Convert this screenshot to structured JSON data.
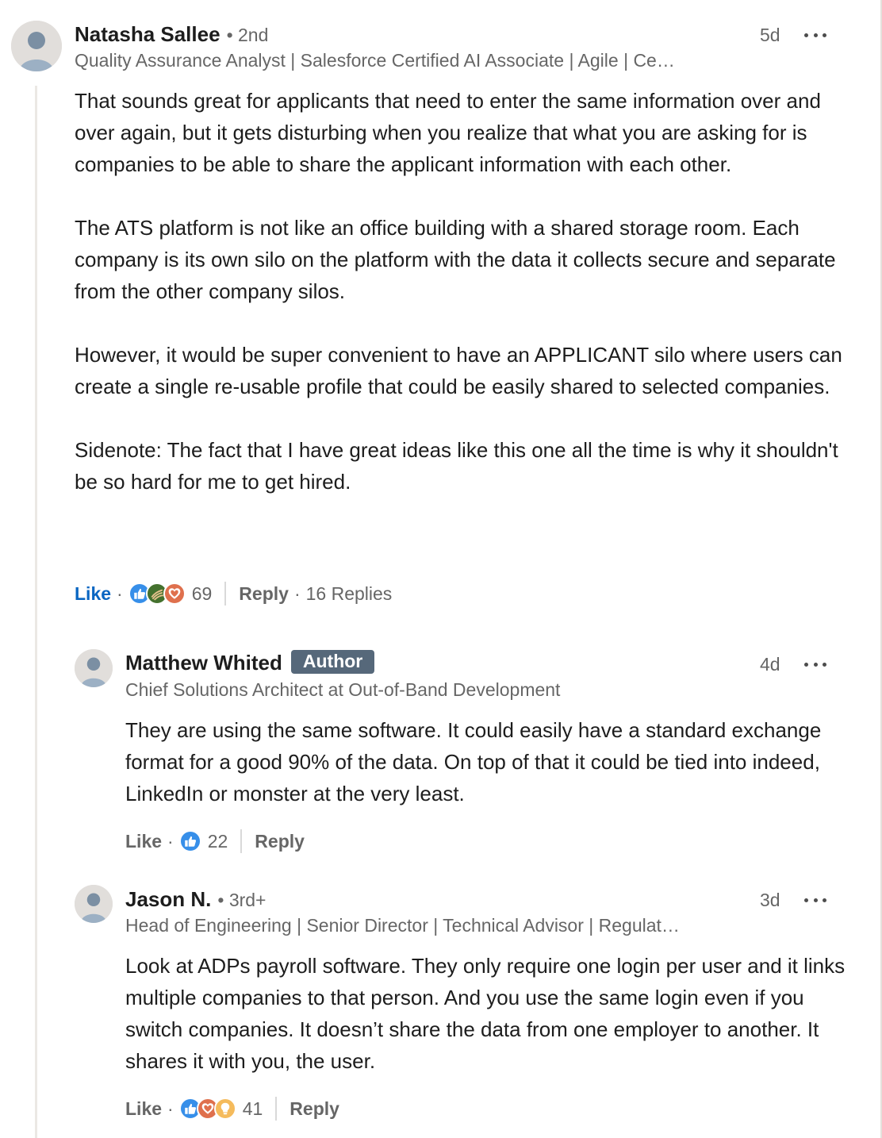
{
  "comments": [
    {
      "name": "Natasha Sallee",
      "degree": "• 2nd",
      "headline": "Quality Assurance Analyst | Salesforce Certified AI Associate | Agile | Ce…",
      "time": "5d",
      "paragraphs": [
        "That sounds great for applicants that need to enter the same information over and over again, but it gets disturbing when you realize that what you are asking for is companies to be able to share the applicant information with each other.",
        "The ATS platform is not like an office building with a shared storage room. Each company is its own silo on the platform with the data it collects secure and separate from the other company silos.",
        "However, it would be super convenient to have an APPLICANT silo where users can create a single re-usable profile that could be easily shared to selected companies.",
        "Sidenote: The fact that I have great ideas like this one all the time is why it shouldn't be so hard for me to get hired."
      ],
      "like_label": "Like",
      "reaction_icons": [
        "like-icon",
        "support-icon",
        "love-icon"
      ],
      "reaction_count": "69",
      "reply_label": "Reply",
      "replies_label": "16 Replies"
    },
    {
      "name": "Matthew Whited",
      "badge": "Author",
      "headline": "Chief Solutions Architect at Out-of-Band Development",
      "time": "4d",
      "paragraphs": [
        "They are using the same software. It could easily have a standard exchange format for a good 90% of the data. On top of that it could be tied into indeed, LinkedIn or monster at the very least."
      ],
      "like_label": "Like",
      "reaction_icons": [
        "like-icon"
      ],
      "reaction_count": "22",
      "reply_label": "Reply"
    },
    {
      "name": "Jason N.",
      "degree": "• 3rd+",
      "headline": "Head of Engineering | Senior Director | Technical Advisor | Regulat…",
      "time": "3d",
      "paragraphs": [
        "Look at ADPs payroll software. They only require one login per user and it links multiple companies to that person. And you use the same login even if you switch companies. It doesn’t share the data from one employer to another. It shares it with you, the user."
      ],
      "like_label": "Like",
      "reaction_icons": [
        "like-icon",
        "love-icon",
        "insightful-icon"
      ],
      "reaction_count": "41",
      "reply_label": "Reply"
    }
  ],
  "colors": {
    "like_active": "#0a66c2",
    "secondary_text": "#666666",
    "author_badge": "#56687a",
    "reaction_like": "#378fe9",
    "reaction_support": "#44712e",
    "reaction_love": "#df704d",
    "reaction_insight": "#f5bb5c"
  }
}
